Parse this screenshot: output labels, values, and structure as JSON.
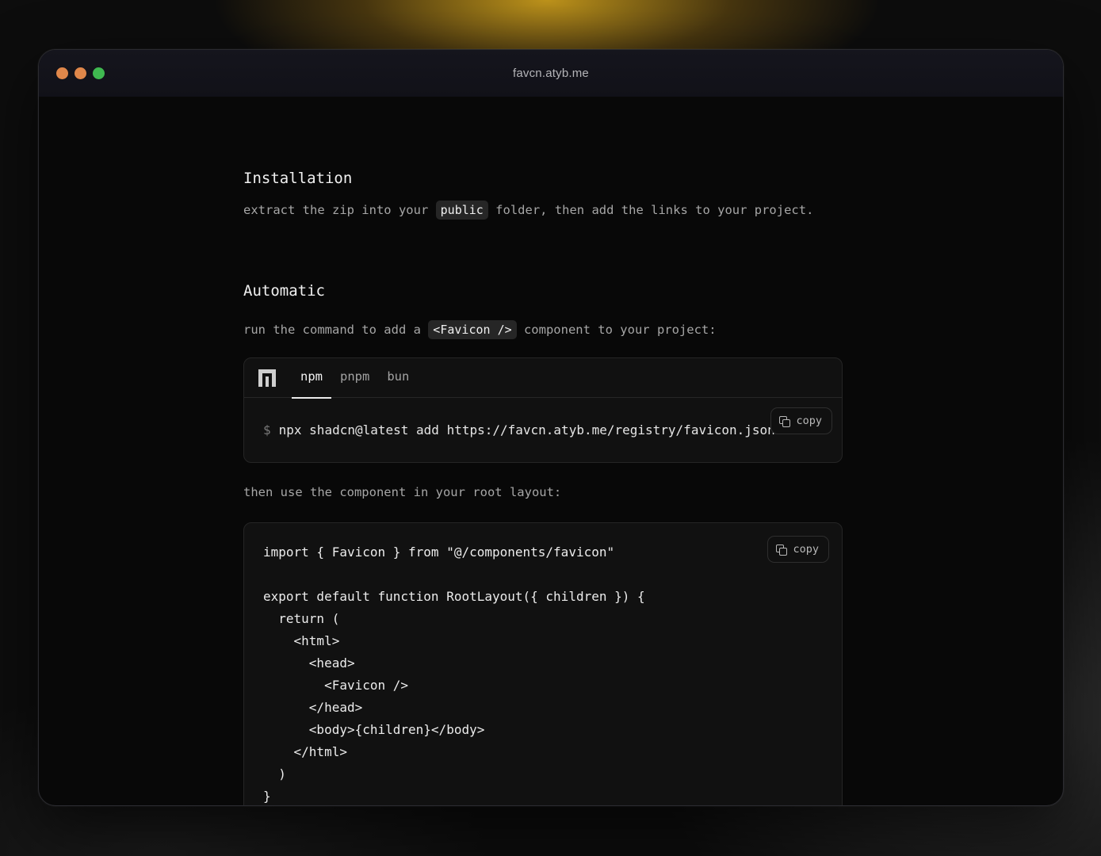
{
  "window": {
    "url": "favcn.atyb.me",
    "traffic_lights": {
      "close_color": "#e0874a",
      "minimize_color": "#e0874a",
      "maximize_color": "#3fb950"
    }
  },
  "installation": {
    "heading": "Installation",
    "text_before": "extract the zip into your ",
    "code": "public",
    "text_after": " folder, then add the links to your project."
  },
  "automatic": {
    "heading": "Automatic",
    "text_before": "run the command to add a ",
    "code": "<Favicon />",
    "text_after": " component to your project:",
    "tabs": [
      {
        "label": "npm",
        "active": true
      },
      {
        "label": "pnpm",
        "active": false
      },
      {
        "label": "bun",
        "active": false
      }
    ],
    "logo_icon": "npm-logo-icon",
    "prompt": "$",
    "command": "npx shadcn@latest add https://favcn.atyb.me/registry/favicon.json",
    "copy_label": "copy",
    "copy_icon": "copy-icon"
  },
  "usage": {
    "text": "then use the component in your root layout:",
    "copy_label": "copy",
    "code": "import { Favicon } from \"@/components/favicon\"\n\nexport default function RootLayout({ children }) {\n  return (\n    <html>\n      <head>\n        <Favicon />\n      </head>\n      <body>{children}</body>\n    </html>\n  )\n}"
  }
}
